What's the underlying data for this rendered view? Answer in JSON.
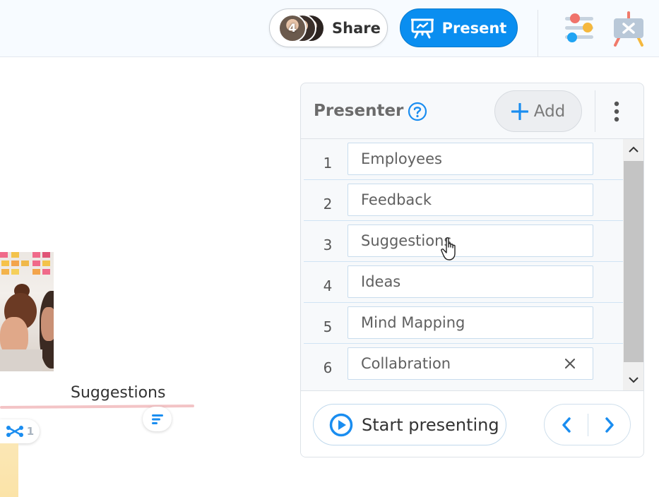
{
  "topbar": {
    "share": {
      "label": "Share",
      "collaborator_count": "4"
    },
    "present": {
      "label": "Present"
    },
    "icons": [
      "settings-sliders-icon",
      "tools-easel-icon"
    ]
  },
  "canvas": {
    "node_label": "Suggestions",
    "link_count": "1",
    "icons": [
      "notes-icon",
      "link-nodes-icon"
    ]
  },
  "presenter": {
    "title": "Presenter",
    "add_label": "Add",
    "slides": [
      {
        "number": "1",
        "label": "Employees"
      },
      {
        "number": "2",
        "label": "Feedback"
      },
      {
        "number": "3",
        "label": "Suggestions"
      },
      {
        "number": "4",
        "label": "Ideas"
      },
      {
        "number": "5",
        "label": "Mind Mapping"
      },
      {
        "number": "6",
        "label": "Collabration"
      }
    ],
    "start_label": "Start presenting"
  },
  "colors": {
    "accent": "#0a8ef0",
    "topbar_bg": "#f7fbff",
    "panel_bg": "#f7f9fb",
    "row_border": "#d0e3f4",
    "underline": "#f3c4c6"
  }
}
